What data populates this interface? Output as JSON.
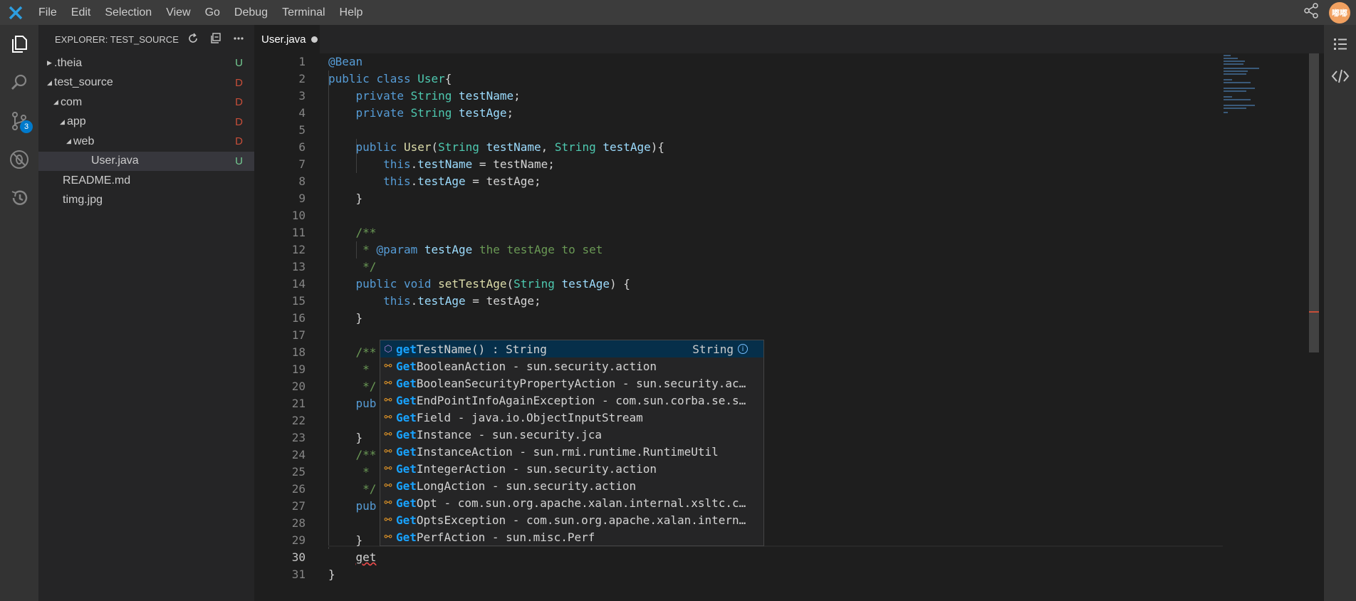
{
  "menubar": {
    "items": [
      "File",
      "Edit",
      "Selection",
      "View",
      "Go",
      "Debug",
      "Terminal",
      "Help"
    ],
    "avatar_text": "嘟嘟"
  },
  "activitybar": {
    "scm_badge": "3"
  },
  "explorer": {
    "title": "EXPLORER: TEST_SOURCE",
    "items": [
      {
        "label": ".theia",
        "status": "U"
      },
      {
        "label": "test_source",
        "status": "D"
      },
      {
        "label": "com",
        "status": "D"
      },
      {
        "label": "app",
        "status": "D"
      },
      {
        "label": "web",
        "status": "D"
      },
      {
        "label": "User.java",
        "status": "U"
      },
      {
        "label": "README.md",
        "status": ""
      },
      {
        "label": "timg.jpg",
        "status": ""
      }
    ]
  },
  "tab": {
    "label": "User.java"
  },
  "editor": {
    "line_numbers": [
      "1",
      "2",
      "3",
      "4",
      "5",
      "6",
      "7",
      "8",
      "9",
      "10",
      "11",
      "12",
      "13",
      "14",
      "15",
      "16",
      "17",
      "18",
      "19",
      "20",
      "21",
      "22",
      "23",
      "24",
      "25",
      "26",
      "27",
      "28",
      "29",
      "30",
      "31"
    ],
    "visible_fragments": {
      "l18": "/**",
      "l19": " *",
      "l20": " */",
      "l21": "pub",
      "l23": "}",
      "l24": "/**",
      "l25": " *",
      "l26": " */",
      "l27": "pub",
      "l29": "}",
      "l30": "get",
      "l31": "}"
    }
  },
  "suggest": {
    "items": [
      {
        "match": "get",
        "rest": "TestName() : String",
        "detail": "String"
      },
      {
        "match": "Get",
        "rest": "BooleanAction - sun.security.action",
        "detail": ""
      },
      {
        "match": "Get",
        "rest": "BooleanSecurityPropertyAction - sun.security.ac…",
        "detail": ""
      },
      {
        "match": "Get",
        "rest": "EndPointInfoAgainException - com.sun.corba.se.s…",
        "detail": ""
      },
      {
        "match": "Get",
        "rest": "Field - java.io.ObjectInputStream",
        "detail": ""
      },
      {
        "match": "Get",
        "rest": "Instance - sun.security.jca",
        "detail": ""
      },
      {
        "match": "Get",
        "rest": "InstanceAction - sun.rmi.runtime.RuntimeUtil",
        "detail": ""
      },
      {
        "match": "Get",
        "rest": "IntegerAction - sun.security.action",
        "detail": ""
      },
      {
        "match": "Get",
        "rest": "LongAction - sun.security.action",
        "detail": ""
      },
      {
        "match": "Get",
        "rest": "Opt - com.sun.org.apache.xalan.internal.xsltc.c…",
        "detail": ""
      },
      {
        "match": "Get",
        "rest": "OptsException - com.sun.org.apache.xalan.intern…",
        "detail": ""
      },
      {
        "match": "Get",
        "rest": "PerfAction - sun.misc.Perf",
        "detail": ""
      }
    ]
  },
  "colors": {
    "accent": "#007acc",
    "git_untracked": "#73c991",
    "git_deleted": "#c74e39",
    "suggest_highlight": "#18a3ff"
  }
}
